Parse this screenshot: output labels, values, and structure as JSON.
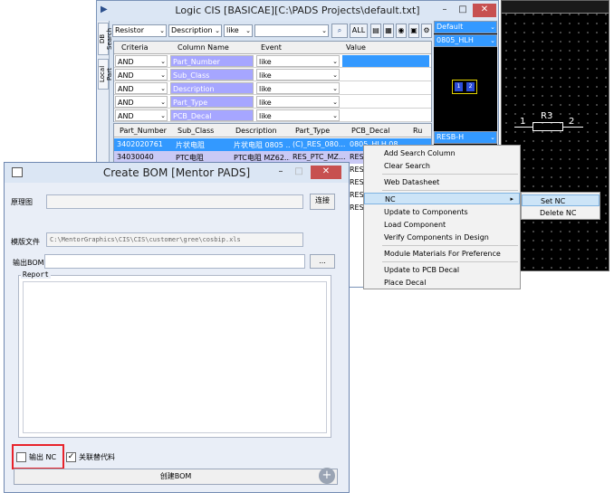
{
  "cis": {
    "title": "Logic CIS  [BASICAE][C:\\PADS Projects\\default.txt]",
    "side_tabs": [
      "DB Search",
      "Local Part"
    ],
    "toolbar": {
      "library": "Resistor",
      "field": "Description",
      "operator": "like",
      "value": "",
      "all_label": "ALL"
    },
    "search_grid": {
      "headers": [
        "Criteria",
        "Column Name",
        "Event",
        "Value"
      ],
      "rows": [
        {
          "criteria": "AND",
          "column": "Part_Number",
          "event": "like"
        },
        {
          "criteria": "AND",
          "column": "Sub_Class",
          "event": "like"
        },
        {
          "criteria": "AND",
          "column": "Description",
          "event": "like"
        },
        {
          "criteria": "AND",
          "column": "Part_Type",
          "event": "like"
        },
        {
          "criteria": "AND",
          "column": "PCB_Decal",
          "event": "like"
        }
      ]
    },
    "results": {
      "headers": [
        "Part_Number",
        "Sub_Class",
        "Description",
        "Part_Type",
        "PCB_Decal",
        "Ru"
      ],
      "rows": [
        [
          "3402020761",
          "片状电阻",
          "片状电阻 0805 ...",
          "(C)_RES_080...",
          "0805_HLH.08..."
        ],
        [
          "34030040",
          "PTC电阻",
          "PTC电阻 MZ62...",
          "RES_PTC_MZ...",
          "RES"
        ],
        [
          "",
          "",
          "",
          "",
          "RES"
        ],
        [
          "",
          "",
          "",
          "",
          "RES"
        ],
        [
          "",
          "",
          "",
          "",
          "RES"
        ],
        [
          "",
          "",
          "",
          "",
          "RES"
        ]
      ]
    },
    "preview": {
      "view_select": "Default",
      "decal_select": "0805_HLH",
      "pin1": "1",
      "pin2": "2",
      "bottom_select": "RESB-H"
    }
  },
  "schematic": {
    "ref": "R3",
    "pin1": "1",
    "pin2": "2"
  },
  "context_menu": {
    "items": [
      "Add Search Column",
      "Clear Search",
      "Web Datasheet",
      "NC",
      "Update to Components",
      "Load Component",
      "Verify Components in Design",
      "Module Materials For Preference",
      "Update to PCB Decal",
      "Place Decal"
    ],
    "highlighted": "NC",
    "submenu": [
      "Set NC",
      "Delete NC"
    ]
  },
  "bom": {
    "title": "Create BOM  [Mentor PADS]",
    "schematic_label": "原理图",
    "schematic_value": "",
    "connect_label": "连接",
    "template_label": "模版文件",
    "template_value": "C:\\MentorGraphics\\CIS\\CIS\\customer\\gree\\cosbip.xls",
    "output_label": "输出BOM",
    "output_value": "",
    "browse_label": "...",
    "report_label": "Report",
    "report_text": "",
    "output_nc_label": "输出 NC",
    "output_nc_checked": false,
    "link_alt_label": "关联替代料",
    "link_alt_checked": true,
    "create_label": "创建BOM"
  },
  "colors": {
    "selection": "#3399ff",
    "column_highlight": "#a6a6ff",
    "annotation_box": "#e8232b",
    "menu_hover": "#cce4f7"
  }
}
